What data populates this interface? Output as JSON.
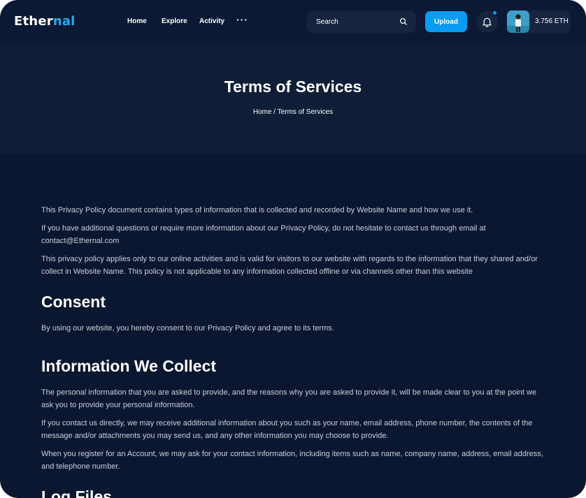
{
  "navbar": {
    "logo_prefix": "Ether",
    "logo_suffix": "nal",
    "links": [
      "Home",
      "Explore",
      "Activity"
    ],
    "more_label": "···",
    "search_placeholder": "Search",
    "upload_label": "Upload",
    "wallet_balance": "3.756 ETH"
  },
  "hero": {
    "title": "Terms of Services",
    "breadcrumb_home": "Home",
    "breadcrumb_sep": " / ",
    "breadcrumb_current": "Terms of Services"
  },
  "content": {
    "intro_1": "This Privacy Policy document contains types of information that is collected and recorded by Website Name and how we use it.",
    "intro_2": "If you have additional questions or require more information about our Privacy Policy, do not hesitate to contact us through email at contact@Ethernal.com",
    "intro_3": "This privacy policy applies only to our online activities and is valid for visitors to our website with regards to the information that they shared and/or collect in Website Name. This policy is not applicable to any information collected offline or via channels other than this website",
    "consent_heading": "Consent",
    "consent_text": "By using our website, you hereby consent to our Privacy Policy and agree to its terms.",
    "info_heading": "Information We Collect",
    "info_1": "The personal information that you are asked to provide, and the reasons why you are asked to provide it, will be made clear to you at the point we ask you to provide your personal information.",
    "info_2": "If you contact us directly, we may receive additional information about you such as your name, email address, phone number, the contents of the message and/or attachments you may send us, and any other information you may choose to provide.",
    "info_3": "When you register for an Account, we may ask for your contact information, including items such as name, company name, address, email address, and telephone number.",
    "log_heading": "Log Files"
  },
  "colors": {
    "background": "#0b1730",
    "accent": "#0a9cf0",
    "text_body": "#c8d0dc"
  }
}
